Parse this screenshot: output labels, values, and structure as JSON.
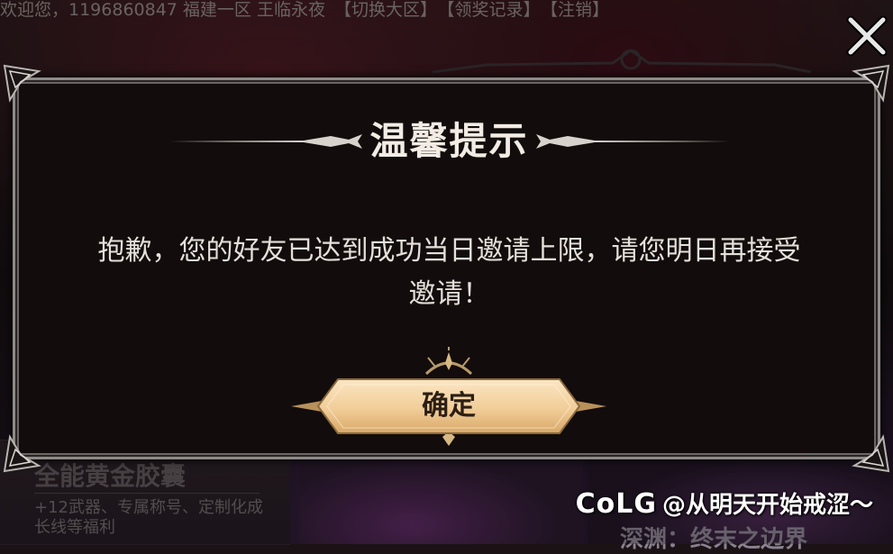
{
  "top_bar": {
    "welcome": "欢迎您，1196860847 福建一区 王临永夜",
    "switch_region": "【切换大区】",
    "reward_log": "【领奖记录】",
    "logout": "【注销】"
  },
  "background": {
    "left_card": {
      "title": "全能黄金胶囊",
      "desc": "+12武器、专属称号、定制化成长线等福利"
    },
    "right_card": {
      "title": "深渊：终末之边界"
    }
  },
  "close_button": {
    "icon": "close-icon"
  },
  "dialog": {
    "title": "温馨提示",
    "message": "抱歉，您的好友已达到成功当日邀请上限，请您明日再接受邀请！",
    "confirm_label": "确定"
  },
  "watermark": {
    "brand": "CoLG",
    "handle": "@从明天开始戒涩～"
  },
  "colors": {
    "modal_bg": "#120c0c",
    "modal_border": "#8e8a88",
    "button_gold": "#f3d3a4",
    "title_text": "#f2ece4"
  }
}
